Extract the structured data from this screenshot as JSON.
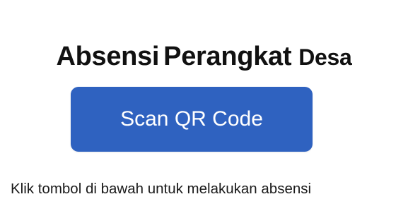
{
  "header": {
    "title_words": [
      "Absensi",
      "Perangkat",
      "Desa"
    ]
  },
  "main": {
    "scan_button_label": "Scan QR Code",
    "instruction_text": "Klik tombol di bawah untuk melakukan absensi"
  },
  "colors": {
    "button_background": "#2f62c0",
    "button_text": "#ffffff",
    "title_text": "#111111",
    "page_background": "#ffffff"
  }
}
